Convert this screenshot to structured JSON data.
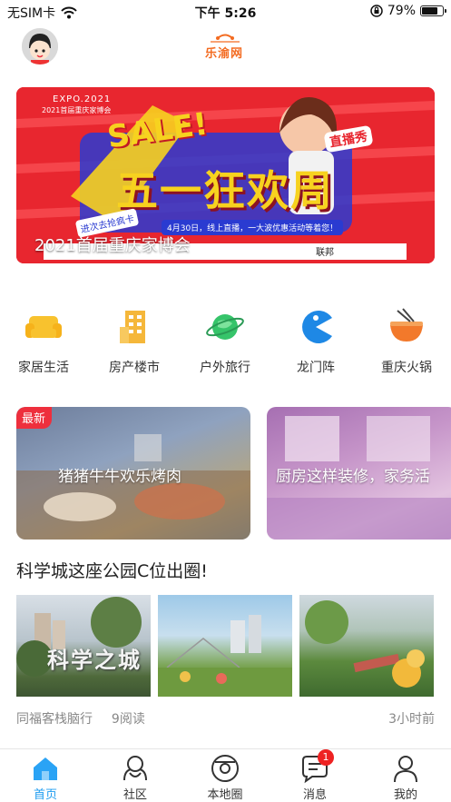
{
  "status_bar": {
    "carrier": "无SIM卡",
    "time": "下午 5:26",
    "battery": "79%",
    "battery_level": 0.79
  },
  "header": {
    "logo_text": "乐渝网"
  },
  "banner": {
    "caption": "2021首届重庆家博会",
    "art_text": [
      "EXPO.2021",
      "2021首届重庆家博会",
      "SALE!",
      "五一狂欢周",
      "直播秀",
      "4月30日，线上直播，一大波优惠活动等着您！",
      "进次去抢疯卡",
      "联邦"
    ]
  },
  "categories": [
    {
      "label": "家居生活",
      "icon": "sofa-icon",
      "color": "#f8c22e"
    },
    {
      "label": "房产楼市",
      "icon": "building-icon",
      "color": "#f5b73a"
    },
    {
      "label": "户外旅行",
      "icon": "planet-icon",
      "color": "#36c46a"
    },
    {
      "label": "龙门阵",
      "icon": "pacman-icon",
      "color": "#1e88e5"
    },
    {
      "label": "重庆火锅",
      "icon": "noodle-bowl-icon",
      "color": "#f2792b"
    }
  ],
  "cards": [
    {
      "badge": "最新",
      "caption": "猪猪牛牛欢乐烤肉"
    },
    {
      "caption": "厨房这样装修，家务活"
    }
  ],
  "article": {
    "title": "科学城这座公园C位出圈!",
    "thumb_text": "科学之城",
    "source": "同福客栈脑行",
    "reads": "9阅读",
    "time": "3小时前"
  },
  "tabbar": {
    "items": [
      {
        "label": "首页",
        "icon": "home-icon",
        "active": true
      },
      {
        "label": "社区",
        "icon": "community-icon"
      },
      {
        "label": "本地圈",
        "icon": "local-circle-icon"
      },
      {
        "label": "消息",
        "icon": "message-icon",
        "badge": "1"
      },
      {
        "label": "我的",
        "icon": "profile-icon"
      }
    ],
    "active_color": "#1e9cf0"
  }
}
